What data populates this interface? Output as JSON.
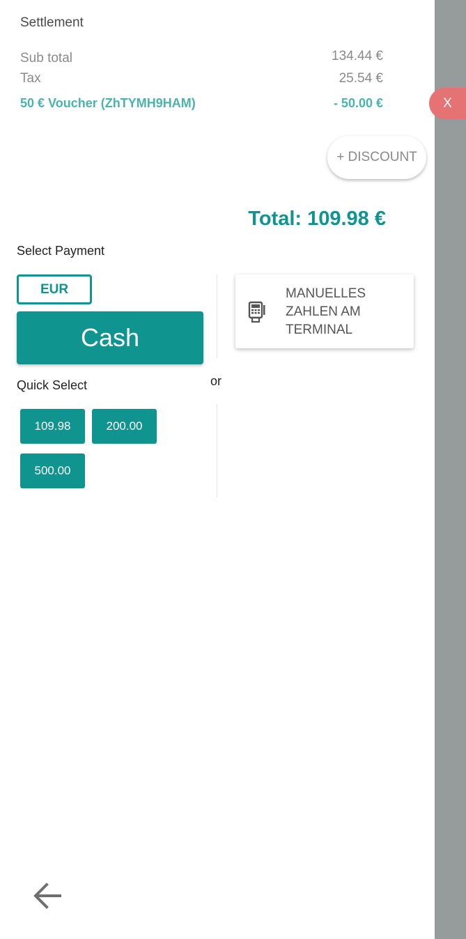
{
  "settlement": {
    "title": "Settlement",
    "subtotal_label": "Sub total",
    "subtotal_value": "134.44 €",
    "tax_label": "Tax",
    "tax_value": "25.54 €",
    "voucher_label": "50 € Voucher (ZhTYMH9HAM)",
    "voucher_value": "- 50.00 €",
    "discount_button": "+ DISCOUNT",
    "total": "Total: 109.98 €"
  },
  "payment": {
    "select_label": "Select Payment",
    "currency": "EUR",
    "cash_label": "Cash",
    "or_label": "or",
    "quick_select_label": "Quick Select",
    "quick_amounts": [
      "109.98",
      "200.00",
      "500.00"
    ],
    "terminal_label": "MANUELLES ZAHLEN AM TERMINAL",
    "terminal_icon": "card-terminal-icon"
  },
  "overlay": {
    "close_label": "X"
  },
  "nav": {
    "back_icon": "arrow-left-icon"
  },
  "colors": {
    "accent": "#0f9490",
    "voucher": "#4bb3ae",
    "close": "#e57373",
    "overlay": "#969b9b"
  }
}
